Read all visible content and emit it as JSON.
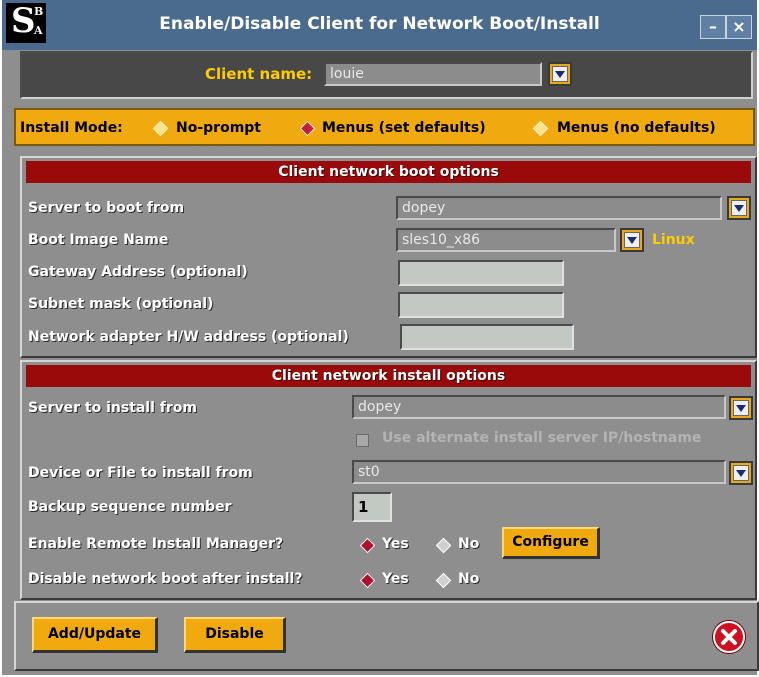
{
  "window": {
    "title": "Enable/Disable Client for Network Boot/Install",
    "logo_letters": "SBA"
  },
  "client": {
    "label": "Client name:",
    "value": "louie"
  },
  "install_mode": {
    "label": "Install Mode:",
    "options": [
      "No-prompt",
      "Menus (set defaults)",
      "Menus (no defaults)"
    ],
    "selected": "Menus (set defaults)"
  },
  "boot_options": {
    "header": "Client network boot options",
    "server_label": "Server to boot from",
    "server_value": "dopey",
    "image_label": "Boot Image Name",
    "image_value": "sles10_x86",
    "image_os": "Linux",
    "gateway_label": "Gateway Address (optional)",
    "gateway_value": "",
    "subnet_label": "Subnet mask (optional)",
    "subnet_value": "",
    "hwaddr_label": "Network adapter H/W address (optional)",
    "hwaddr_value": ""
  },
  "install_options": {
    "header": "Client network install options",
    "server_label": "Server to install from",
    "server_value": "dopey",
    "alt_label": "Use alternate install server IP/hostname",
    "device_label": "Device or File to install from",
    "device_value": "st0",
    "backup_label": "Backup sequence number",
    "backup_value": "1",
    "rim_label": "Enable Remote Install Manager?",
    "rim_yes": "Yes",
    "rim_no": "No",
    "configure_label": "Configure",
    "disable_label": "Disable network boot after install?",
    "disable_yes": "Yes",
    "disable_no": "No"
  },
  "footer": {
    "add_label": "Add/Update",
    "disable_label": "Disable"
  },
  "colors": {
    "accent": "#f0a90f",
    "section_header": "#9a0a0a",
    "titlebar": "#4a6b8e",
    "close": "#d01020"
  }
}
